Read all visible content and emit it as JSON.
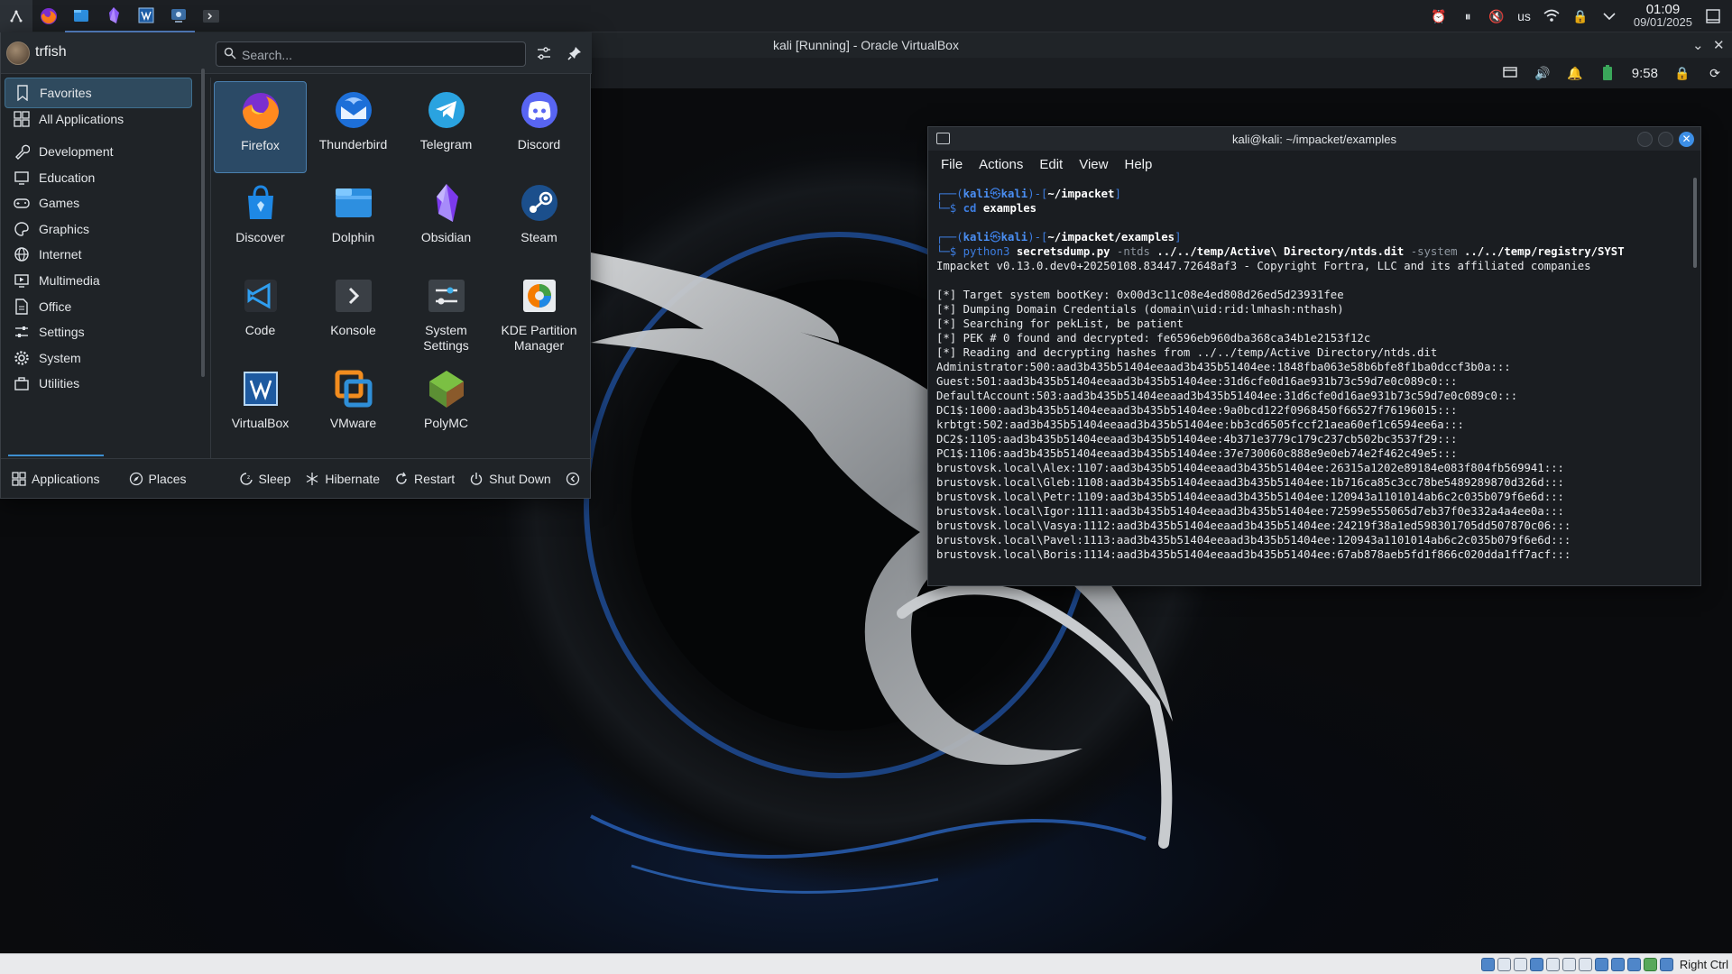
{
  "host_panel": {
    "tasks": [
      "kde-app-launcher",
      "firefox",
      "dolphin",
      "obsidian",
      "virtualbox",
      "network-manager",
      "konsole"
    ],
    "tray": {
      "keyboard_layout": "us"
    },
    "clock": {
      "time": "01:09",
      "date": "09/01/2025"
    }
  },
  "vbox": {
    "title": "kali [Running] - Oracle VirtualBox",
    "host_key": "Right Ctrl"
  },
  "guest_panel": {
    "time": "9:58"
  },
  "launcher": {
    "username": "trfish",
    "search_placeholder": "Search...",
    "categories": [
      {
        "label": "Favorites",
        "icon": "bookmark-icon"
      },
      {
        "label": "All Applications",
        "icon": "grid-icon"
      },
      {
        "label": "Development",
        "icon": "wrench-icon"
      },
      {
        "label": "Education",
        "icon": "monitor-icon"
      },
      {
        "label": "Games",
        "icon": "gamepad-icon"
      },
      {
        "label": "Graphics",
        "icon": "palette-icon"
      },
      {
        "label": "Internet",
        "icon": "globe-icon"
      },
      {
        "label": "Multimedia",
        "icon": "media-icon"
      },
      {
        "label": "Office",
        "icon": "document-icon"
      },
      {
        "label": "Settings",
        "icon": "sliders-icon"
      },
      {
        "label": "System",
        "icon": "gear-icon"
      },
      {
        "label": "Utilities",
        "icon": "toolbox-icon"
      }
    ],
    "apps": [
      {
        "label": "Firefox",
        "icon": "firefox-icon"
      },
      {
        "label": "Thunderbird",
        "icon": "thunderbird-icon"
      },
      {
        "label": "Telegram",
        "icon": "telegram-icon"
      },
      {
        "label": "Discord",
        "icon": "discord-icon"
      },
      {
        "label": "Discover",
        "icon": "discover-icon"
      },
      {
        "label": "Dolphin",
        "icon": "dolphin-icon"
      },
      {
        "label": "Obsidian",
        "icon": "obsidian-icon"
      },
      {
        "label": "Steam",
        "icon": "steam-icon"
      },
      {
        "label": "Code",
        "icon": "vscode-icon"
      },
      {
        "label": "Konsole",
        "icon": "konsole-icon"
      },
      {
        "label": "System Settings",
        "icon": "system-settings-icon"
      },
      {
        "label": "KDE Partition Manager",
        "icon": "partition-manager-icon"
      },
      {
        "label": "VirtualBox",
        "icon": "virtualbox-icon"
      },
      {
        "label": "VMware",
        "icon": "vmware-icon"
      },
      {
        "label": "PolyMC",
        "icon": "polymc-icon"
      }
    ],
    "footer": {
      "applications": "Applications",
      "places": "Places",
      "sleep": "Sleep",
      "hibernate": "Hibernate",
      "restart": "Restart",
      "shutdown": "Shut Down"
    }
  },
  "terminal": {
    "title": "kali@kali: ~/impacket/examples",
    "menu": [
      "File",
      "Actions",
      "Edit",
      "View",
      "Help"
    ],
    "prompt1": {
      "user": "kali",
      "host": "kali",
      "path": "~/impacket",
      "cmd": "cd",
      "arg": "examples"
    },
    "prompt2": {
      "user": "kali",
      "host": "kali",
      "path": "~/impacket/examples",
      "cmd": "python3",
      "script": "secretsdump.py",
      "opt1": "-ntds",
      "arg1": "../../temp/Active\\ Directory/ntds.dit",
      "opt2": "-system",
      "arg2": "../../temp/registry/SYST"
    },
    "output": [
      "Impacket v0.13.0.dev0+20250108.83447.72648af3 - Copyright Fortra, LLC and its affiliated companies",
      "",
      "[*] Target system bootKey: 0x00d3c11c08e4ed808d26ed5d23931fee",
      "[*] Dumping Domain Credentials (domain\\uid:rid:lmhash:nthash)",
      "[*] Searching for pekList, be patient",
      "[*] PEK # 0 found and decrypted: fe6596eb960dba368ca34b1e2153f12c",
      "[*] Reading and decrypting hashes from ../../temp/Active Directory/ntds.dit",
      "Administrator:500:aad3b435b51404eeaad3b435b51404ee:1848fba063e58b6bfe8f1ba0dccf3b0a:::",
      "Guest:501:aad3b435b51404eeaad3b435b51404ee:31d6cfe0d16ae931b73c59d7e0c089c0:::",
      "DefaultAccount:503:aad3b435b51404eeaad3b435b51404ee:31d6cfe0d16ae931b73c59d7e0c089c0:::",
      "DC1$:1000:aad3b435b51404eeaad3b435b51404ee:9a0bcd122f0968450f66527f76196015:::",
      "krbtgt:502:aad3b435b51404eeaad3b435b51404ee:bb3cd6505fccf21aea60ef1c6594ee6a:::",
      "DC2$:1105:aad3b435b51404eeaad3b435b51404ee:4b371e3779c179c237cb502bc3537f29:::",
      "PC1$:1106:aad3b435b51404eeaad3b435b51404ee:37e730060c888e9e0eb74e2f462c49e5:::",
      "brustovsk.local\\Alex:1107:aad3b435b51404eeaad3b435b51404ee:26315a1202e89184e083f804fb569941:::",
      "brustovsk.local\\Gleb:1108:aad3b435b51404eeaad3b435b51404ee:1b716ca85c3cc78be5489289870d326d:::",
      "brustovsk.local\\Petr:1109:aad3b435b51404eeaad3b435b51404ee:120943a1101014ab6c2c035b079f6e6d:::",
      "brustovsk.local\\Igor:1111:aad3b435b51404eeaad3b435b51404ee:72599e555065d7eb37f0e332a4a4ee0a:::",
      "brustovsk.local\\Vasya:1112:aad3b435b51404eeaad3b435b51404ee:24219f38a1ed598301705dd507870c06:::",
      "brustovsk.local\\Pavel:1113:aad3b435b51404eeaad3b435b51404ee:120943a1101014ab6c2c035b079f6e6d:::",
      "brustovsk.local\\Boris:1114:aad3b435b51404eeaad3b435b51404ee:67ab878aeb5fd1f866c020dda1ff7acf:::"
    ]
  }
}
